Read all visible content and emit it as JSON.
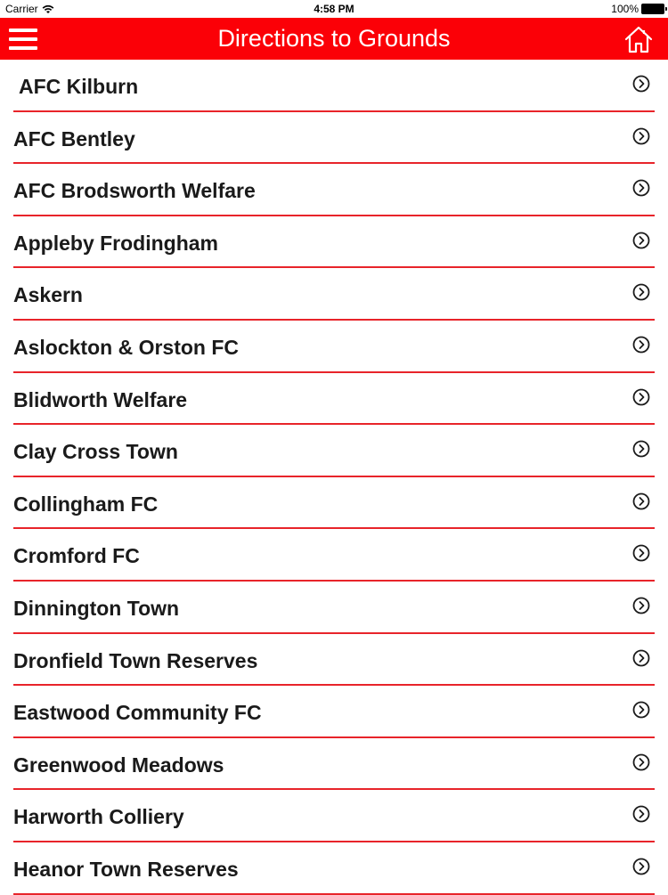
{
  "status_bar": {
    "carrier": "Carrier",
    "time": "4:58 PM",
    "battery": "100%"
  },
  "nav": {
    "title": "Directions to Grounds",
    "menu_icon": "hamburger-menu-icon",
    "home_icon": "home-icon"
  },
  "colors": {
    "accent": "#fb0007",
    "divider": "#e8242a",
    "text": "#1a1a1a"
  },
  "grounds": [
    {
      "label": "AFC Kilburn"
    },
    {
      "label": "AFC Bentley"
    },
    {
      "label": "AFC Brodsworth Welfare"
    },
    {
      "label": "Appleby Frodingham"
    },
    {
      "label": "Askern"
    },
    {
      "label": "Aslockton & Orston FC"
    },
    {
      "label": "Blidworth Welfare"
    },
    {
      "label": "Clay Cross Town"
    },
    {
      "label": "Collingham FC"
    },
    {
      "label": "Cromford FC"
    },
    {
      "label": "Dinnington Town"
    },
    {
      "label": "Dronfield Town Reserves"
    },
    {
      "label": "Eastwood Community FC"
    },
    {
      "label": "Greenwood Meadows"
    },
    {
      "label": "Harworth Colliery"
    },
    {
      "label": "Heanor Town Reserves"
    }
  ]
}
